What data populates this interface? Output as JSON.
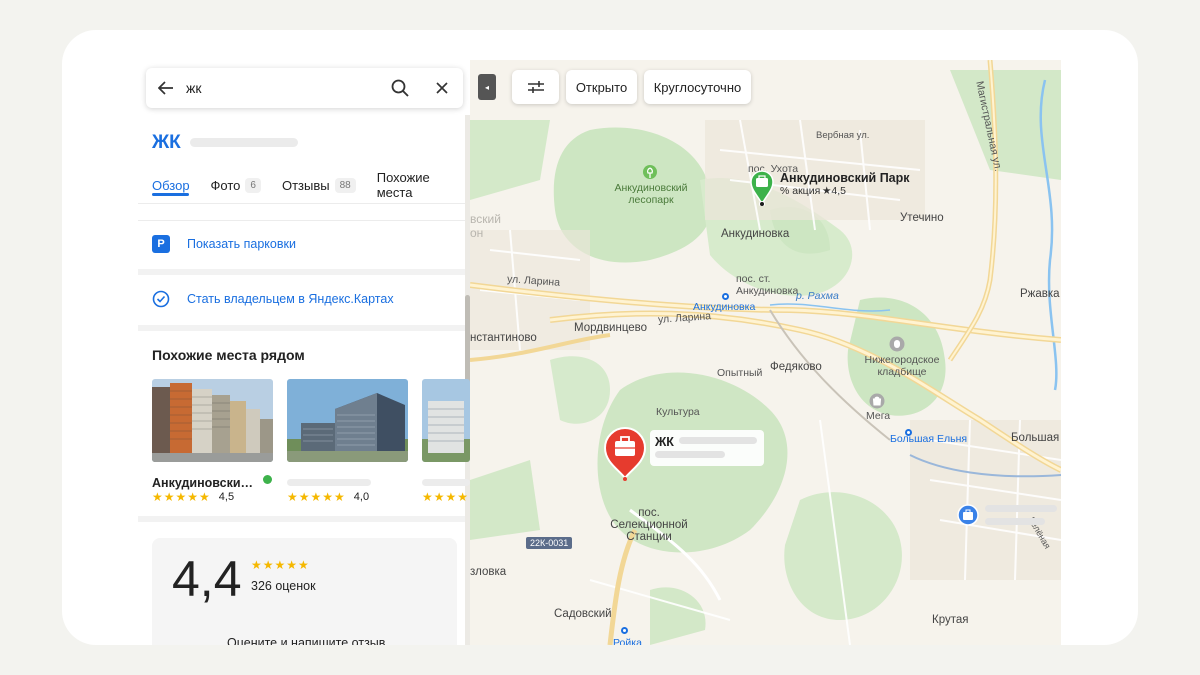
{
  "search": {
    "query": "жк"
  },
  "place": {
    "title": "ЖК",
    "tabs": [
      {
        "label": "Обзор"
      },
      {
        "label": "Фото",
        "count": "6"
      },
      {
        "label": "Отзывы",
        "count": "88"
      },
      {
        "label": "Похожие места"
      }
    ],
    "parking_label": "Показать парковки",
    "parking_icon_letter": "P",
    "owner_label": "Стать владельцем в Яндекс.Картах"
  },
  "nearby": {
    "heading": "Похожие места рядом",
    "items": [
      {
        "name": "Анкудиновский ...",
        "stars": "★★★★★",
        "rating": "4,5"
      },
      {
        "stars": "★★★★★",
        "rating": "4,0"
      },
      {
        "stars": "★★★★★"
      }
    ]
  },
  "rating": {
    "value": "4,4",
    "stars": "★★★★★",
    "count": "326 оценок",
    "cta": "Оцените и напишите отзыв"
  },
  "map": {
    "filters": {
      "open": "Открыто",
      "round_clock": "Круглосуточно"
    },
    "collapse_glyph": "◂",
    "ank_park": {
      "name": "Анкудиновский Парк",
      "promo": "% акция",
      "rating": "★4,5"
    },
    "jk_pin": {
      "name": "ЖК"
    },
    "road_badge": "22К-0031",
    "labels": {
      "magistral": "Магистральная ул.",
      "verbnaya": "Вербная ул.",
      "pos_ukhota": "пос. Ухота",
      "forest": "Анкудиновский лесопарк",
      "ankudinovka": "Анкудиновка",
      "utechino": "Утечино",
      "pos_st_ank": "пос. ст. Анкудиновка",
      "ank_station": "Анкудиновка",
      "rakhma": "р. Рахма",
      "larina1": "ул. Ларина",
      "larina2": "ул. Ларина",
      "mordvintsevo": "Мордвинцево",
      "konstantinovo": "нстантиново",
      "zhavka": "Ржавка",
      "cemetery": "Нижегородское кладбище",
      "opytny": "Опытный",
      "fedyakovo": "Федяково",
      "mega": "Мега",
      "kultura": "Культура",
      "bolshaya_elnya": "Большая Ельня",
      "bolshaya": "Большая",
      "selektsionnoy": "пос. Селекционной Станции",
      "zvlovka": "зловка",
      "sadovsky": "Садовский",
      "royka": "Ройка",
      "krutaya": "Крутая",
      "zelenaya": "Зелёная",
      "district": "вский он"
    }
  },
  "colors": {
    "accent": "#1a6fe0",
    "star": "#f5b800",
    "pin_red": "#e63b2e",
    "park_green": "#3db24b"
  }
}
